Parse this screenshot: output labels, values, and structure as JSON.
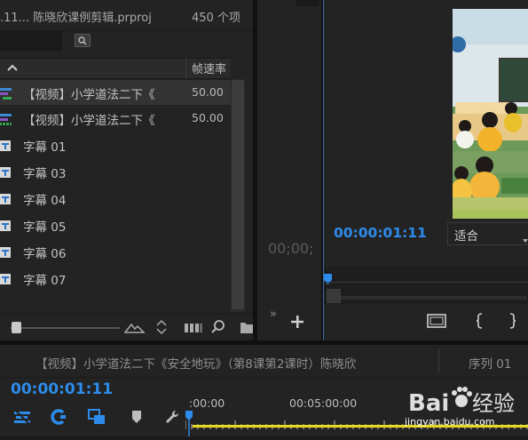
{
  "project": {
    "title": ".11... 陈晓欣课例剪辑.prproj",
    "item_count": "450 个项",
    "search_placeholder": "",
    "column_frame_rate": "帧速率",
    "items": [
      {
        "label": "【视频】小学道法二下《",
        "fps": "50.00",
        "icon": "sequence-icon",
        "selected": true
      },
      {
        "label": "【视频】小学道法二下《",
        "fps": "50.00",
        "icon": "sequence-icon",
        "selected": false
      },
      {
        "label": "字幕 01",
        "fps": "",
        "icon": "title-icon",
        "selected": false
      },
      {
        "label": "字幕 03",
        "fps": "",
        "icon": "title-icon",
        "selected": false
      },
      {
        "label": "字幕 04",
        "fps": "",
        "icon": "title-icon",
        "selected": false
      },
      {
        "label": "字幕 05",
        "fps": "",
        "icon": "title-icon",
        "selected": false
      },
      {
        "label": "字幕 06",
        "fps": "",
        "icon": "title-icon",
        "selected": false
      },
      {
        "label": "字幕 07",
        "fps": "",
        "icon": "title-icon",
        "selected": false
      }
    ]
  },
  "source_monitor": {
    "timecode": "00;00;",
    "more_symbol": "»"
  },
  "program_monitor": {
    "timecode": "00:00:01:11",
    "fit_option": "适合"
  },
  "timeline": {
    "sequence_title": "【视频】小学道法二下《安全地玩》（第8课第2课时）陈晓欣",
    "sequence_tab": "序列 01",
    "timecode": "00:00:01:11",
    "ruler_labels": [
      ":00:00",
      "00:05:00:00"
    ]
  },
  "watermark": {
    "text": "jingyan.baidu.com"
  },
  "colors": {
    "accent_blue": "#2d8ceb",
    "panel_bg": "#232323",
    "work_area": "#e7d91d"
  }
}
